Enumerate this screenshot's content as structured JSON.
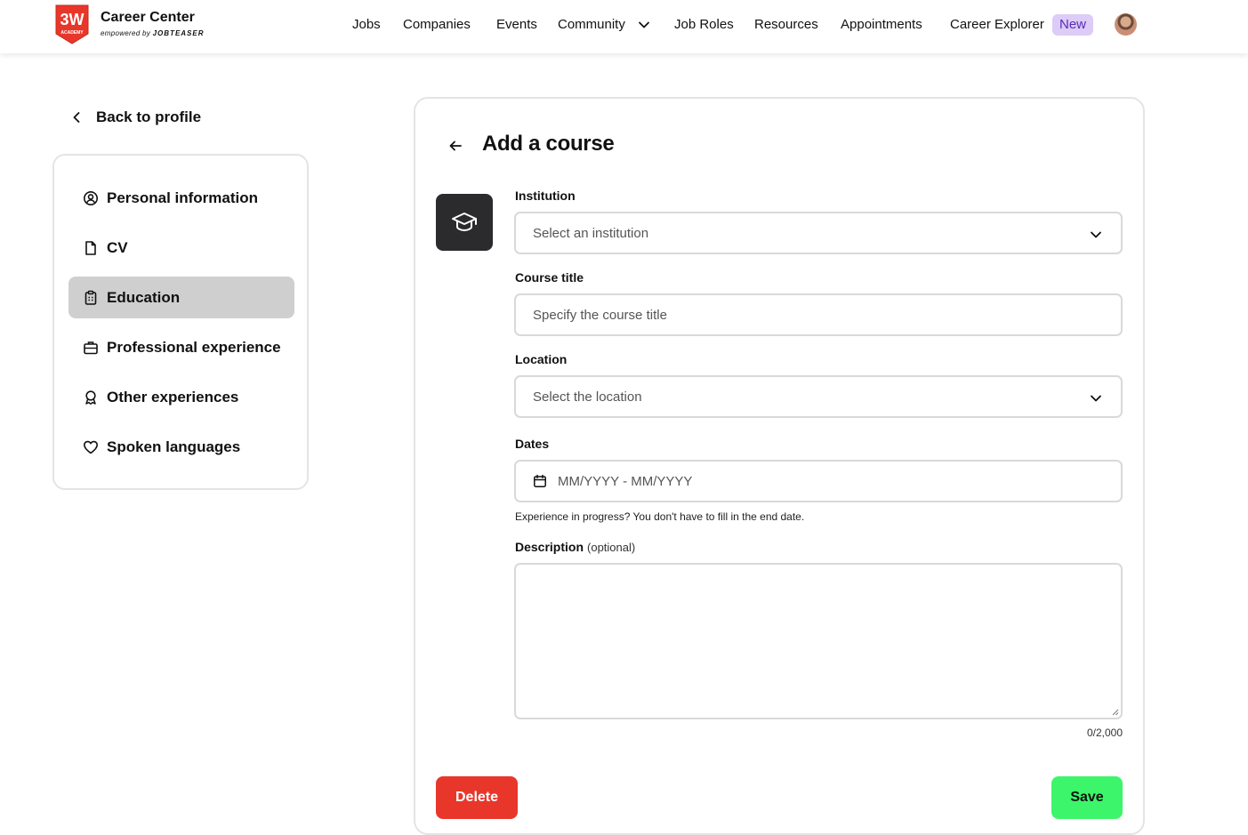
{
  "header": {
    "logo_text": "3W ACADEMY",
    "brand_title": "Career Center",
    "brand_sub_prefix": "empowered by",
    "brand_sub_name": "JOBTEASER",
    "nav": {
      "jobs": "Jobs",
      "companies": "Companies",
      "events": "Events",
      "community": "Community",
      "job_roles": "Job Roles",
      "resources": "Resources",
      "appointments": "Appointments",
      "career_explorer": "Career Explorer",
      "new_badge": "New"
    }
  },
  "sidebar": {
    "back_label": "Back to profile",
    "items": {
      "personal": "Personal information",
      "cv": "CV",
      "education": "Education",
      "professional": "Professional experience",
      "other": "Other experiences",
      "languages": "Spoken languages"
    },
    "active_item": "Education"
  },
  "form": {
    "title": "Add a course",
    "institution": {
      "label": "Institution",
      "placeholder": "Select an institution"
    },
    "course_title": {
      "label": "Course title",
      "placeholder": "Specify the course title"
    },
    "location": {
      "label": "Location",
      "placeholder": "Select the location"
    },
    "dates": {
      "label": "Dates",
      "placeholder": "MM/YYYY - MM/YYYY",
      "hint": "Experience in progress? You don't have to fill in the end date."
    },
    "description": {
      "label": "Description",
      "optional": "(optional)",
      "counter": "0/2,000"
    },
    "delete_label": "Delete",
    "save_label": "Save"
  },
  "colors": {
    "brand_red": "#e8372a",
    "save_green": "#3df56a",
    "badge_bg": "#dcccf7",
    "badge_text": "#5b2bb5",
    "active_bg": "#cfcfcf"
  }
}
